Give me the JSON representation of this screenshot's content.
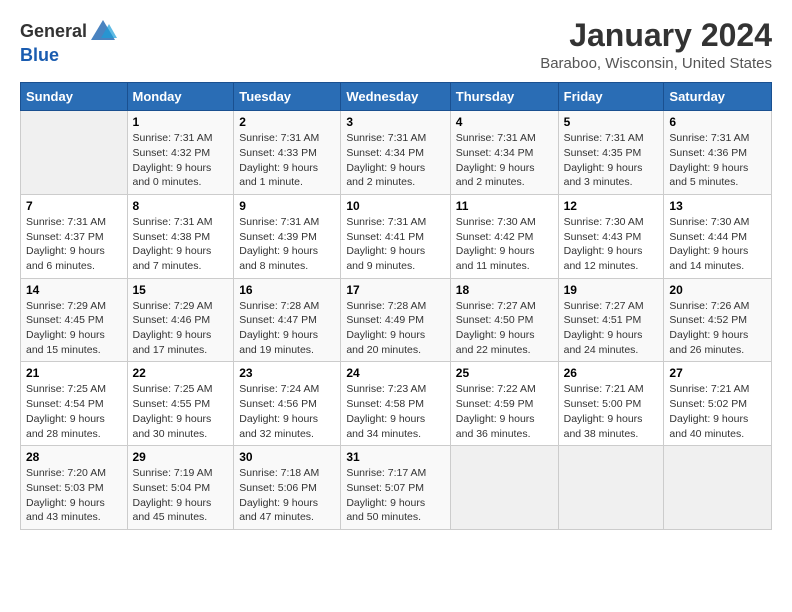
{
  "logo": {
    "general": "General",
    "blue": "Blue"
  },
  "header": {
    "title": "January 2024",
    "subtitle": "Baraboo, Wisconsin, United States"
  },
  "columns": [
    "Sunday",
    "Monday",
    "Tuesday",
    "Wednesday",
    "Thursday",
    "Friday",
    "Saturday"
  ],
  "weeks": [
    [
      {
        "day": "",
        "empty": true
      },
      {
        "day": "1",
        "sunrise": "7:31 AM",
        "sunset": "4:32 PM",
        "daylight": "9 hours and 0 minutes."
      },
      {
        "day": "2",
        "sunrise": "7:31 AM",
        "sunset": "4:33 PM",
        "daylight": "9 hours and 1 minute."
      },
      {
        "day": "3",
        "sunrise": "7:31 AM",
        "sunset": "4:34 PM",
        "daylight": "9 hours and 2 minutes."
      },
      {
        "day": "4",
        "sunrise": "7:31 AM",
        "sunset": "4:34 PM",
        "daylight": "9 hours and 2 minutes."
      },
      {
        "day": "5",
        "sunrise": "7:31 AM",
        "sunset": "4:35 PM",
        "daylight": "9 hours and 3 minutes."
      },
      {
        "day": "6",
        "sunrise": "7:31 AM",
        "sunset": "4:36 PM",
        "daylight": "9 hours and 5 minutes."
      }
    ],
    [
      {
        "day": "7",
        "sunrise": "7:31 AM",
        "sunset": "4:37 PM",
        "daylight": "9 hours and 6 minutes."
      },
      {
        "day": "8",
        "sunrise": "7:31 AM",
        "sunset": "4:38 PM",
        "daylight": "9 hours and 7 minutes."
      },
      {
        "day": "9",
        "sunrise": "7:31 AM",
        "sunset": "4:39 PM",
        "daylight": "9 hours and 8 minutes."
      },
      {
        "day": "10",
        "sunrise": "7:31 AM",
        "sunset": "4:41 PM",
        "daylight": "9 hours and 9 minutes."
      },
      {
        "day": "11",
        "sunrise": "7:30 AM",
        "sunset": "4:42 PM",
        "daylight": "9 hours and 11 minutes."
      },
      {
        "day": "12",
        "sunrise": "7:30 AM",
        "sunset": "4:43 PM",
        "daylight": "9 hours and 12 minutes."
      },
      {
        "day": "13",
        "sunrise": "7:30 AM",
        "sunset": "4:44 PM",
        "daylight": "9 hours and 14 minutes."
      }
    ],
    [
      {
        "day": "14",
        "sunrise": "7:29 AM",
        "sunset": "4:45 PM",
        "daylight": "9 hours and 15 minutes."
      },
      {
        "day": "15",
        "sunrise": "7:29 AM",
        "sunset": "4:46 PM",
        "daylight": "9 hours and 17 minutes."
      },
      {
        "day": "16",
        "sunrise": "7:28 AM",
        "sunset": "4:47 PM",
        "daylight": "9 hours and 19 minutes."
      },
      {
        "day": "17",
        "sunrise": "7:28 AM",
        "sunset": "4:49 PM",
        "daylight": "9 hours and 20 minutes."
      },
      {
        "day": "18",
        "sunrise": "7:27 AM",
        "sunset": "4:50 PM",
        "daylight": "9 hours and 22 minutes."
      },
      {
        "day": "19",
        "sunrise": "7:27 AM",
        "sunset": "4:51 PM",
        "daylight": "9 hours and 24 minutes."
      },
      {
        "day": "20",
        "sunrise": "7:26 AM",
        "sunset": "4:52 PM",
        "daylight": "9 hours and 26 minutes."
      }
    ],
    [
      {
        "day": "21",
        "sunrise": "7:25 AM",
        "sunset": "4:54 PM",
        "daylight": "9 hours and 28 minutes."
      },
      {
        "day": "22",
        "sunrise": "7:25 AM",
        "sunset": "4:55 PM",
        "daylight": "9 hours and 30 minutes."
      },
      {
        "day": "23",
        "sunrise": "7:24 AM",
        "sunset": "4:56 PM",
        "daylight": "9 hours and 32 minutes."
      },
      {
        "day": "24",
        "sunrise": "7:23 AM",
        "sunset": "4:58 PM",
        "daylight": "9 hours and 34 minutes."
      },
      {
        "day": "25",
        "sunrise": "7:22 AM",
        "sunset": "4:59 PM",
        "daylight": "9 hours and 36 minutes."
      },
      {
        "day": "26",
        "sunrise": "7:21 AM",
        "sunset": "5:00 PM",
        "daylight": "9 hours and 38 minutes."
      },
      {
        "day": "27",
        "sunrise": "7:21 AM",
        "sunset": "5:02 PM",
        "daylight": "9 hours and 40 minutes."
      }
    ],
    [
      {
        "day": "28",
        "sunrise": "7:20 AM",
        "sunset": "5:03 PM",
        "daylight": "9 hours and 43 minutes."
      },
      {
        "day": "29",
        "sunrise": "7:19 AM",
        "sunset": "5:04 PM",
        "daylight": "9 hours and 45 minutes."
      },
      {
        "day": "30",
        "sunrise": "7:18 AM",
        "sunset": "5:06 PM",
        "daylight": "9 hours and 47 minutes."
      },
      {
        "day": "31",
        "sunrise": "7:17 AM",
        "sunset": "5:07 PM",
        "daylight": "9 hours and 50 minutes."
      },
      {
        "day": "",
        "empty": true
      },
      {
        "day": "",
        "empty": true
      },
      {
        "day": "",
        "empty": true
      }
    ]
  ]
}
